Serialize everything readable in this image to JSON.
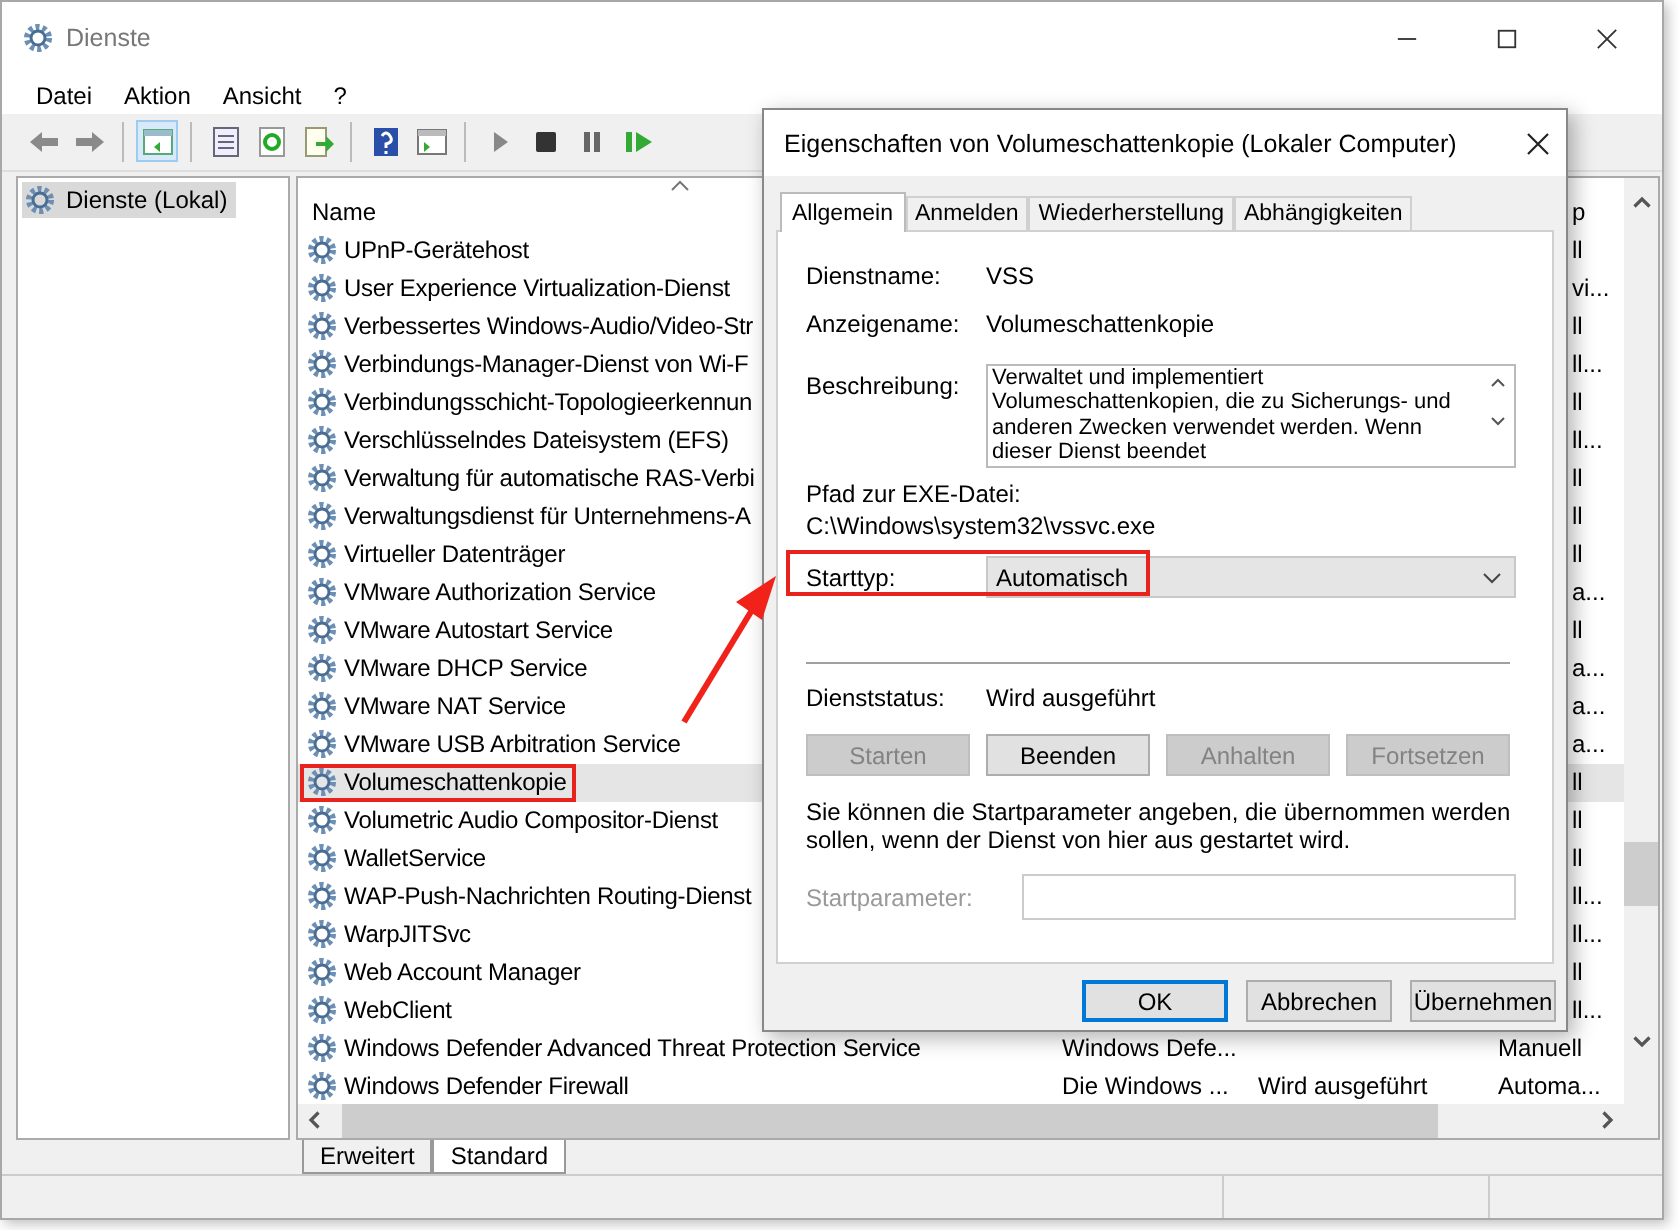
{
  "window": {
    "title": "Dienste"
  },
  "menu": [
    "Datei",
    "Aktion",
    "Ansicht",
    "?"
  ],
  "toolbar_groups": [
    [
      {
        "kind": "back",
        "selected": false
      },
      {
        "kind": "forward",
        "selected": false
      }
    ],
    [
      {
        "kind": "tree",
        "selected": true
      }
    ],
    [
      {
        "kind": "properties",
        "selected": false
      },
      {
        "kind": "refresh",
        "selected": false
      },
      {
        "kind": "export",
        "selected": false
      }
    ],
    [
      {
        "kind": "help",
        "selected": false
      },
      {
        "kind": "view",
        "selected": false
      }
    ],
    [
      {
        "kind": "play",
        "selected": false
      },
      {
        "kind": "stop",
        "selected": false
      },
      {
        "kind": "pause",
        "selected": false
      },
      {
        "kind": "restart",
        "selected": false
      }
    ]
  ],
  "tree": [
    {
      "label": "Dienste (Lokal)",
      "selected": true
    }
  ],
  "list": {
    "columns": [
      {
        "label": "Name",
        "sorted": true
      },
      {
        "label": "p"
      }
    ],
    "rows": [
      {
        "kind": "covered",
        "name": "UPnP-Gerätehost",
        "column_4": "ll",
        "selected": false,
        "highlighted": false
      },
      {
        "kind": "covered",
        "name": "User Experience Virtualization-Dienst",
        "column_4": "vi...",
        "selected": false,
        "highlighted": false
      },
      {
        "kind": "covered",
        "name": "Verbessertes Windows-Audio/Video-Str",
        "column_4": "ll",
        "selected": false,
        "highlighted": false
      },
      {
        "kind": "covered",
        "name": "Verbindungs-Manager-Dienst von Wi-F",
        "column_4": "ll...",
        "selected": false,
        "highlighted": false
      },
      {
        "kind": "covered",
        "name": "Verbindungsschicht-Topologieerkennun",
        "column_4": "ll",
        "selected": false,
        "highlighted": false
      },
      {
        "kind": "covered",
        "name": "Verschlüsselndes Dateisystem (EFS)",
        "column_4": "ll...",
        "selected": false,
        "highlighted": false
      },
      {
        "kind": "covered",
        "name": "Verwaltung für automatische RAS-Verbi",
        "column_4": "ll",
        "selected": false,
        "highlighted": false
      },
      {
        "kind": "covered",
        "name": "Verwaltungsdienst für Unternehmens-A",
        "column_4": "ll",
        "selected": false,
        "highlighted": false
      },
      {
        "kind": "covered",
        "name": "Virtueller Datenträger",
        "column_4": "ll",
        "selected": false,
        "highlighted": false
      },
      {
        "kind": "covered",
        "name": "VMware Authorization Service",
        "column_4": "a...",
        "selected": false,
        "highlighted": false
      },
      {
        "kind": "covered",
        "name": "VMware Autostart Service",
        "column_4": "ll",
        "selected": false,
        "highlighted": false
      },
      {
        "kind": "covered",
        "name": "VMware DHCP Service",
        "column_4": "a...",
        "selected": false,
        "highlighted": false
      },
      {
        "kind": "covered",
        "name": "VMware NAT Service",
        "column_4": "a...",
        "selected": false,
        "highlighted": false
      },
      {
        "kind": "covered",
        "name": "VMware USB Arbitration Service",
        "column_4": "a...",
        "selected": false,
        "highlighted": false
      },
      {
        "kind": "covered",
        "name": "Volumeschattenkopie",
        "column_4": "ll",
        "selected": true,
        "highlighted": true
      },
      {
        "kind": "covered",
        "name": "Volumetric Audio Compositor-Dienst",
        "column_4": "ll",
        "selected": false,
        "highlighted": false
      },
      {
        "kind": "covered",
        "name": "WalletService",
        "column_4": "ll",
        "selected": false,
        "highlighted": false
      },
      {
        "kind": "covered",
        "name": "WAP-Push-Nachrichten Routing-Dienst",
        "column_4": "ll...",
        "selected": false,
        "highlighted": false
      },
      {
        "kind": "covered",
        "name": "WarpJITSvc",
        "column_4": "ll...",
        "selected": false,
        "highlighted": false
      },
      {
        "kind": "covered",
        "name": "Web Account Manager",
        "column_4": "ll",
        "selected": false,
        "highlighted": false
      },
      {
        "kind": "covered",
        "name": "WebClient",
        "column_4": "ll...",
        "selected": false,
        "highlighted": false
      },
      {
        "kind": "full",
        "name": "Windows Defender Advanced Threat Protection Service",
        "column_2": "Windows Defe...",
        "column_4": "Manuell",
        "selected": false,
        "highlighted": false
      },
      {
        "kind": "full",
        "name": "Windows Defender Firewall",
        "column_2": "Die Windows ...",
        "column_3": "Wird ausgeführt",
        "column_4": "Automa...",
        "selected": false,
        "highlighted": false
      }
    ]
  },
  "view_tabs": [
    {
      "label": "Erweitert",
      "selected": false
    },
    {
      "label": "Standard",
      "selected": true
    }
  ],
  "dialog": {
    "title": "Eigenschaften von Volumeschattenkopie (Lokaler Computer)",
    "tabs": [
      {
        "label": "Allgemein",
        "selected": true
      },
      {
        "label": "Anmelden",
        "selected": false
      },
      {
        "label": "Wiederherstellung",
        "selected": false
      },
      {
        "label": "Abhängigkeiten",
        "selected": false
      }
    ],
    "service_name": {
      "label": "Dienstname:",
      "value": "VSS"
    },
    "display_name": {
      "label": "Anzeigename:",
      "value": "Volumeschattenkopie"
    },
    "description": {
      "label": "Beschreibung:",
      "value": "Verwaltet und implementiert Volumeschattenkopien, die zu Sicherungs- und anderen Zwecken verwendet werden. Wenn dieser Dienst beendet"
    },
    "exe_path": {
      "label": "Pfad zur EXE-Datei:",
      "value": "C:\\Windows\\system32\\vssvc.exe"
    },
    "startup_type": {
      "label": "Starttyp:",
      "value": "Automatisch",
      "highlighted": true
    },
    "service_status": {
      "label": "Dienststatus:",
      "value": "Wird ausgeführt"
    },
    "control_buttons": [
      {
        "label": "Starten",
        "disabled": true
      },
      {
        "label": "Beenden",
        "disabled": false
      },
      {
        "label": "Anhalten",
        "disabled": true
      },
      {
        "label": "Fortsetzen",
        "disabled": true
      }
    ],
    "hint": "Sie können die Startparameter angeben, die übernommen werden sollen, wenn der Dienst von hier aus gestartet wird.",
    "start_parameters": {
      "label": "Startparameter:",
      "disabled": true
    },
    "buttons": [
      {
        "label": "OK",
        "default": true
      },
      {
        "label": "Abbrechen",
        "default": false
      },
      {
        "label": "Übernehmen",
        "default": false
      }
    ]
  }
}
